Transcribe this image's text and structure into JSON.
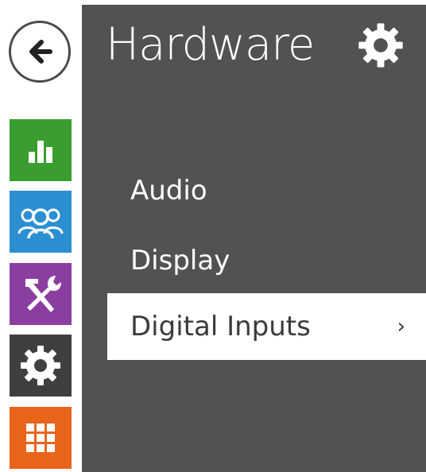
{
  "header": {
    "title": "Hardware",
    "icon": "gear-icon"
  },
  "sidebar": {
    "back": {
      "icon": "back-arrow-icon"
    },
    "items": [
      {
        "name": "status",
        "icon": "bar-chart-icon",
        "color": "#3a9d2f"
      },
      {
        "name": "directory",
        "icon": "users-icon",
        "color": "#2b8fd2"
      },
      {
        "name": "services",
        "icon": "tools-icon",
        "color": "#8a3fa0"
      },
      {
        "name": "hardware",
        "icon": "gear-icon",
        "color": "#3f3f3f"
      },
      {
        "name": "system",
        "icon": "grid-icon",
        "color": "#e8641b"
      }
    ]
  },
  "menu": {
    "items": [
      {
        "label": "Audio",
        "active": false
      },
      {
        "label": "Display",
        "active": false
      },
      {
        "label": "Digital Inputs",
        "active": true
      }
    ],
    "chevron": "›"
  },
  "colors": {
    "panel_bg": "#525252",
    "active_bg": "#ffffff",
    "text_light": "#ffffff",
    "text_dark": "#3b3b3b"
  }
}
